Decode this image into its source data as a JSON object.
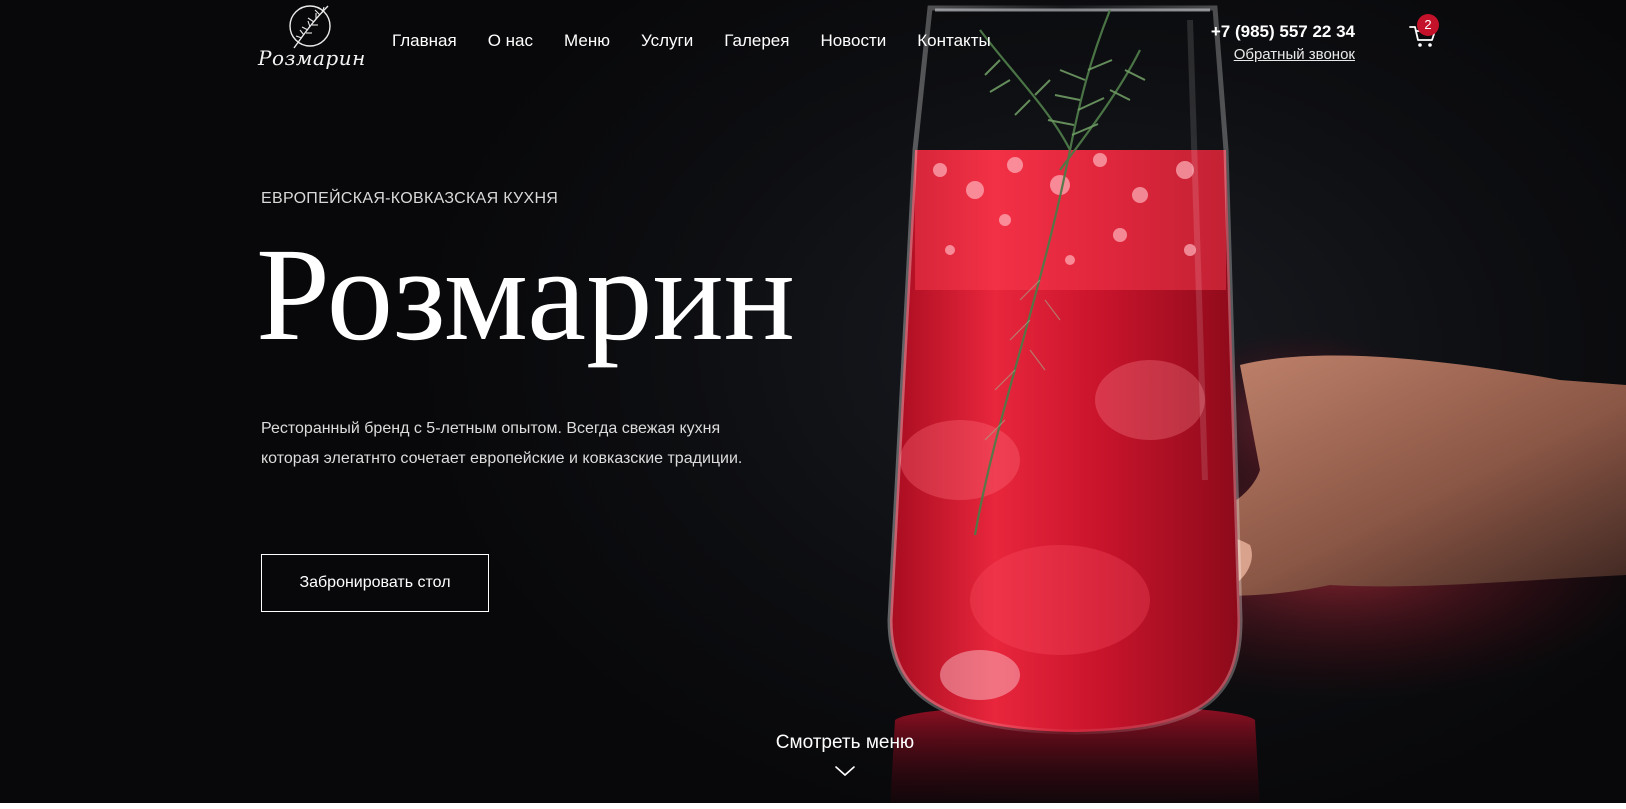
{
  "brand": {
    "logo_text": "Розмарин"
  },
  "nav": {
    "items": [
      "Главная",
      "О нас",
      "Меню",
      "Услуги",
      "Галерея",
      "Новости",
      "Контакты"
    ]
  },
  "contact": {
    "phone": "+7 (985) 557 22 34",
    "callback_label": "Обратный звонок"
  },
  "cart": {
    "count": "2",
    "icon": "cart-icon",
    "badge_color": "#c4122a"
  },
  "hero": {
    "subtitle": "ЕВРОПЕЙСКАЯ-КОВКАЗСКАЯ КУХНЯ",
    "title": "Розмарин",
    "description": "Ресторанный бренд с 5-летным опытом. Всегда свежая кухня которая элегатнто сочетает европейские и ковказские традиции.",
    "book_button": "Забронировать стол",
    "view_menu": "Смотреть меню",
    "view_menu_icon": "chevron-down-icon"
  },
  "colors": {
    "background": "#0b0b0d",
    "drink_red": "#d8172f",
    "text": "#ffffff"
  }
}
